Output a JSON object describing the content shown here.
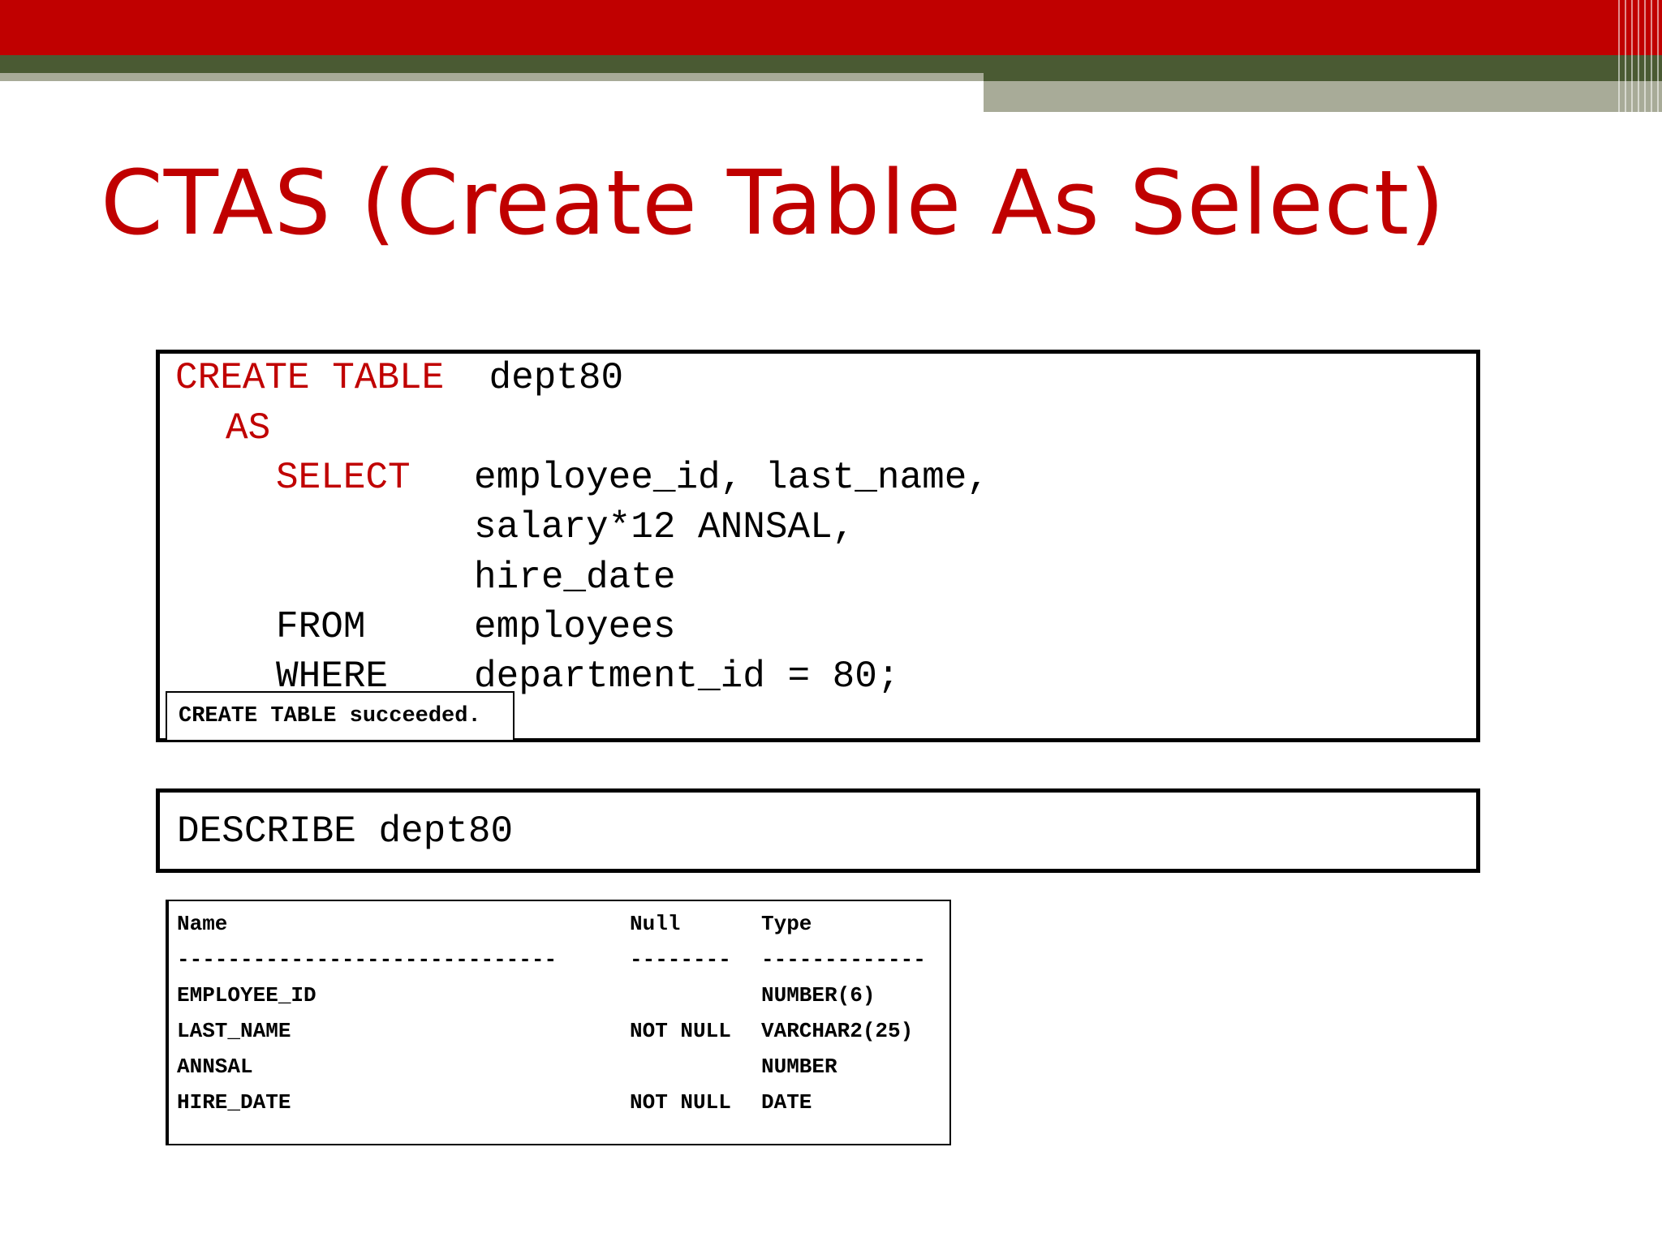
{
  "slide": {
    "title": "CTAS (Create Table As Select)"
  },
  "colors": {
    "accent_red": "#c00000",
    "dark_green": "#4a5a33",
    "gray_green": "#a8ab98"
  },
  "code": {
    "line1_kw": "CREATE TABLE",
    "line1_rest": "dept80",
    "line2_kw": "AS",
    "line3_kw": "SELECT",
    "line3_rest": "employee_id, last_name,",
    "line4": "salary*12 ANNSAL,",
    "line5": "hire_date",
    "line6_kw": "FROM",
    "line6_rest": "employees",
    "line7_kw": "WHERE",
    "line7_rest": "department_id = 80;",
    "status": "CREATE TABLE succeeded."
  },
  "describe": {
    "command": "DESCRIBE dept80"
  },
  "result": {
    "headers": [
      "Name",
      "Null",
      "Type"
    ],
    "separator": [
      "------------------------------",
      "--------",
      "-------------"
    ],
    "rows": [
      [
        "EMPLOYEE_ID",
        "",
        "NUMBER(6)"
      ],
      [
        "LAST_NAME",
        "NOT NULL",
        "VARCHAR2(25)"
      ],
      [
        "ANNSAL",
        "",
        "NUMBER"
      ],
      [
        "HIRE_DATE",
        "NOT NULL",
        "DATE"
      ]
    ]
  }
}
